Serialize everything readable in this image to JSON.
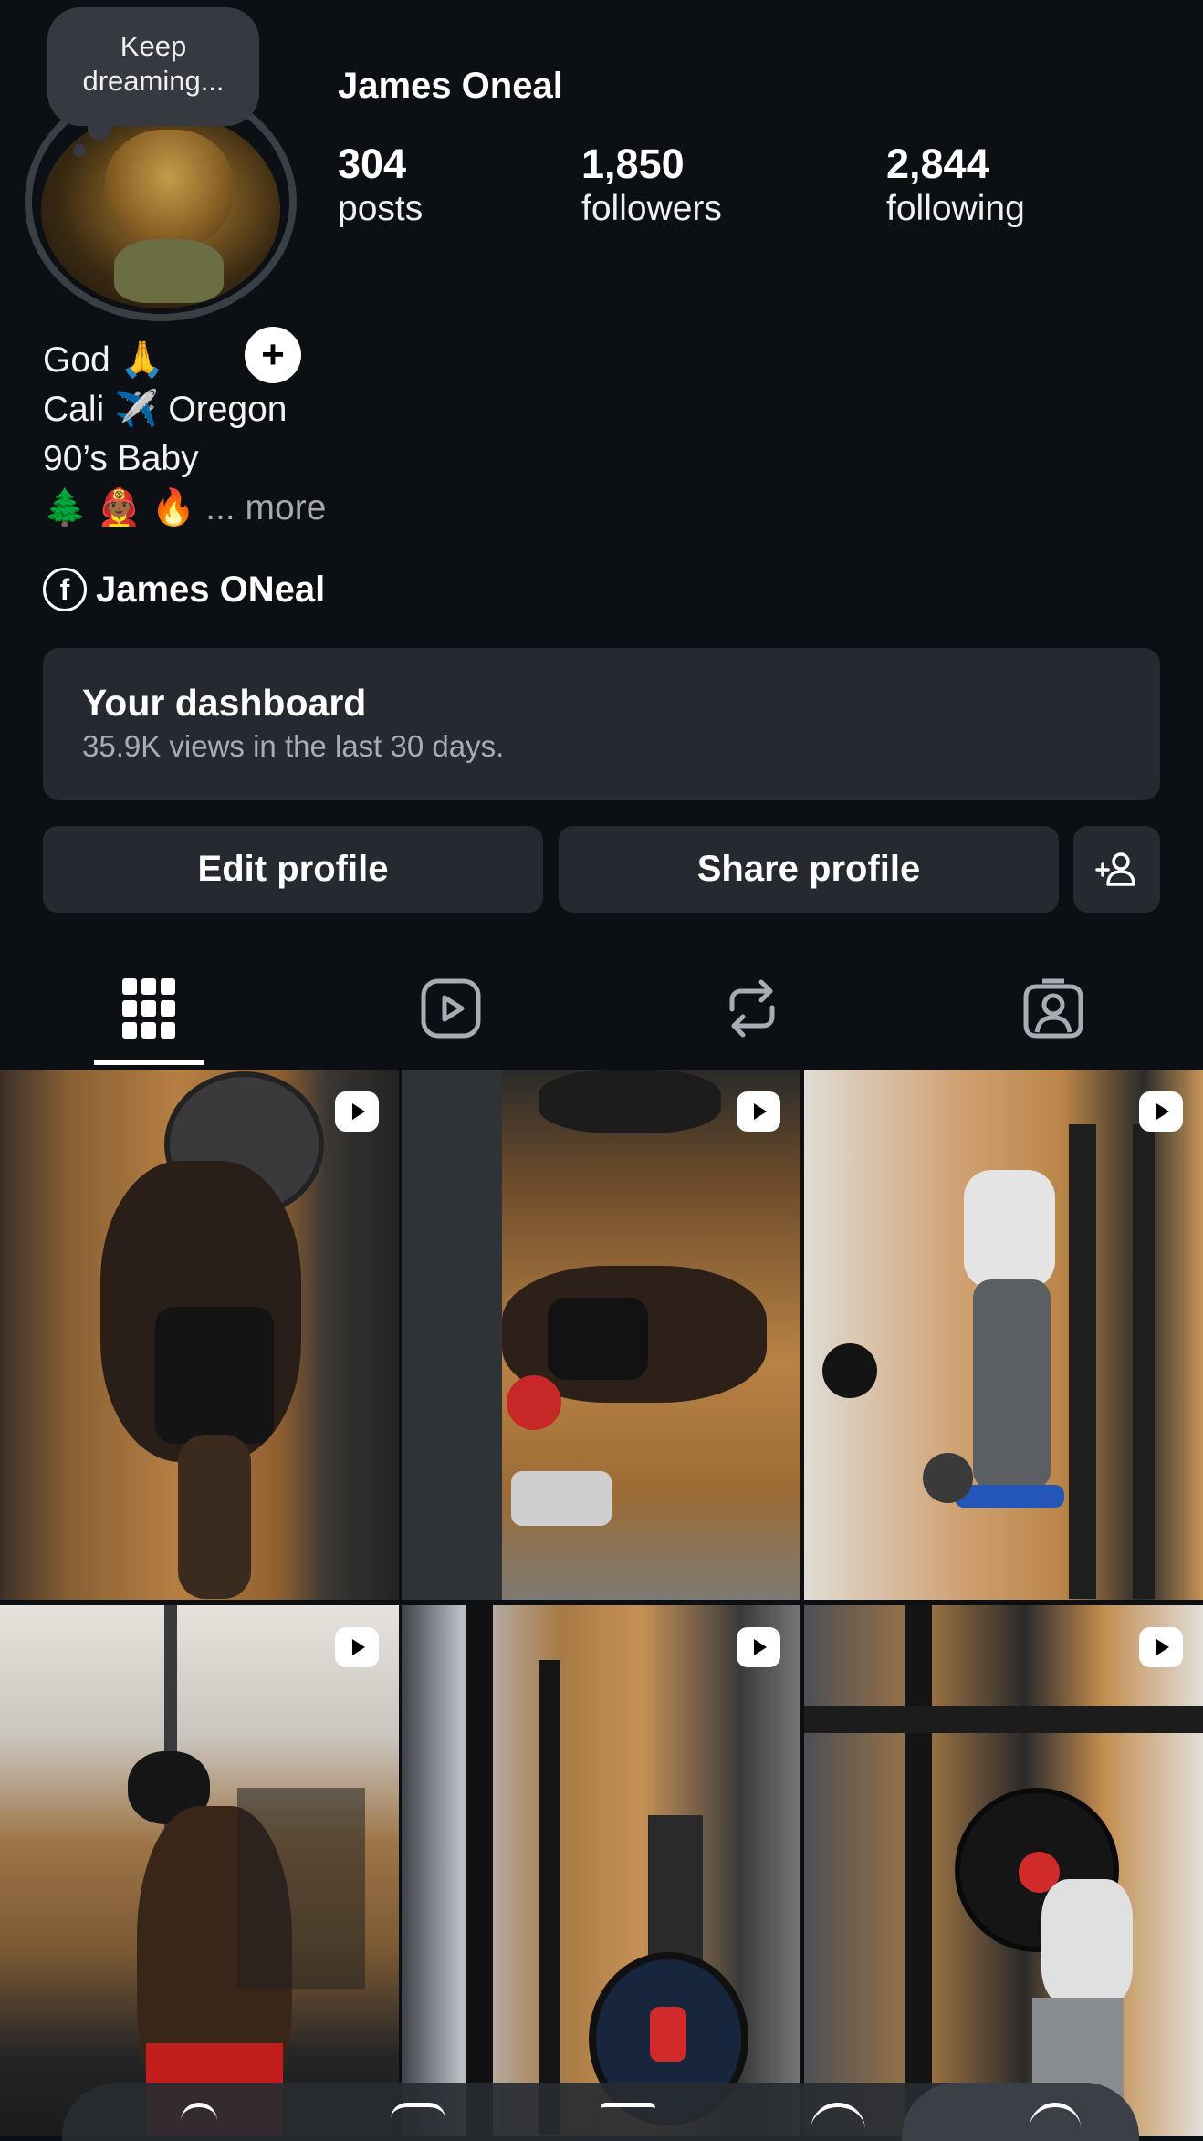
{
  "profile": {
    "note": [
      "Keep",
      "dreaming..."
    ],
    "username": "James Oneal",
    "stats": {
      "posts": {
        "count": "304",
        "label": "posts"
      },
      "followers": {
        "count": "1,850",
        "label": "followers"
      },
      "following": {
        "count": "2,844",
        "label": "following"
      }
    },
    "bio": {
      "line1": "God 🙏",
      "line2": "Cali ✈️ Oregon",
      "line3": "90’s Baby",
      "line4_emoji": "🌲 👨🏾‍🚒 🔥",
      "more": "... more"
    },
    "facebook_link": "James ONeal"
  },
  "dashboard": {
    "title": "Your dashboard",
    "subtitle": "35.9K views in the last 30 days."
  },
  "buttons": {
    "edit": "Edit profile",
    "share": "Share profile"
  },
  "tabs": [
    "grid-icon",
    "reels-icon",
    "reposts-icon",
    "tagged-icon"
  ],
  "colors": {
    "background": "#0c1014",
    "surface": "#262a30",
    "text": "#ffffff",
    "muted": "#a8adb4"
  }
}
